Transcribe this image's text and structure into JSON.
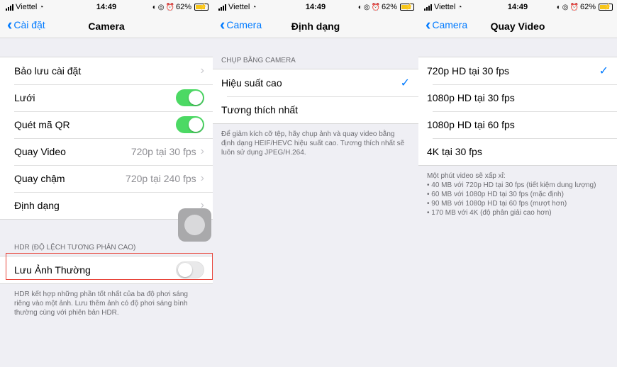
{
  "status": {
    "carrier": "Viettel",
    "time": "14:49",
    "battery": "62%"
  },
  "screen1": {
    "back": "Cài đặt",
    "title": "Camera",
    "rows": [
      {
        "label": "Bảo lưu cài đặt",
        "value": ""
      },
      {
        "label": "Lưới",
        "toggle": "on"
      },
      {
        "label": "Quét mã QR",
        "toggle": "on"
      },
      {
        "label": "Quay Video",
        "value": "720p tại 30 fps"
      },
      {
        "label": "Quay chậm",
        "value": "720p tại 240 fps"
      },
      {
        "label": "Định dạng",
        "value": ""
      }
    ],
    "hdr_header": "HDR (ĐỘ LỆCH TƯƠNG PHẢN CAO)",
    "hdr_row": {
      "label": "Lưu Ảnh Thường",
      "toggle": "off"
    },
    "hdr_footer": "HDR kết hợp những phần tốt nhất của ba độ phơi sáng riêng vào một ảnh. Lưu thêm ảnh có độ phơi sáng bình thường cùng với phiên bản HDR."
  },
  "screen2": {
    "back": "Camera",
    "title": "Định dạng",
    "header": "CHỤP BẰNG CAMERA",
    "rows": [
      {
        "label": "Hiệu suất cao",
        "checked": true
      },
      {
        "label": "Tương thích nhất",
        "checked": false
      }
    ],
    "footer": "Để giảm kích cỡ tệp, hãy chụp ảnh và quay video bằng định dạng HEIF/HEVC hiệu suất cao. Tương thích nhất sẽ luôn sử dụng JPEG/H.264."
  },
  "screen3": {
    "back": "Camera",
    "title": "Quay Video",
    "rows": [
      {
        "label": "720p HD tại 30 fps",
        "checked": true
      },
      {
        "label": "1080p HD tại 30 fps",
        "checked": false
      },
      {
        "label": "1080p HD tại 60 fps",
        "checked": false
      },
      {
        "label": "4K tại 30 fps",
        "checked": false
      }
    ],
    "footer": [
      "Một phút video sẽ xấp xỉ:",
      "• 40 MB với 720p HD tại 30 fps (tiết kiệm dung lượng)",
      "• 60 MB với 1080p HD tại 30 fps (mặc định)",
      "• 90 MB với 1080p HD tại 60 fps (mượt hơn)",
      "• 170 MB với 4K (độ phân giải cao hơn)"
    ]
  },
  "icons": {
    "signal": "signal-bars-icon",
    "wifi": "wifi-icon",
    "rotation_lock": "rotation-lock-icon",
    "alarm": "alarm-icon",
    "battery": "battery-charging-icon",
    "back": "chevron-left-icon",
    "disclosure": "chevron-right-icon",
    "check": "checkmark-icon"
  },
  "colors": {
    "accent": "#007aff",
    "toggle_on": "#4cd964",
    "highlight": "#e8463c",
    "battery": "#f5c518"
  }
}
